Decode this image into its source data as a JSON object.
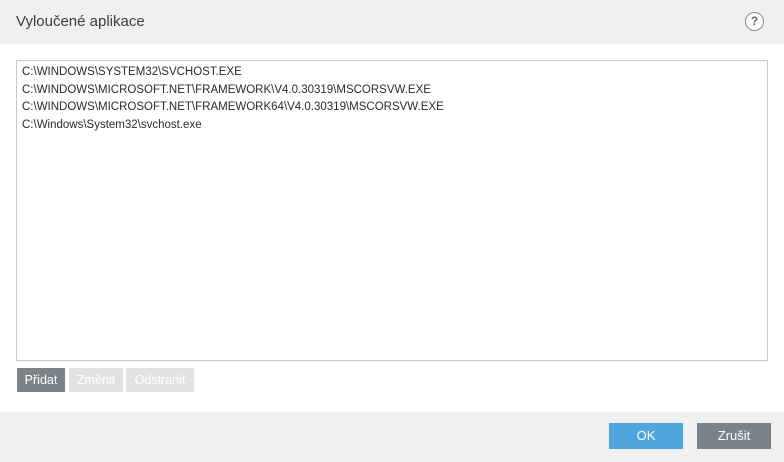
{
  "dialog": {
    "title": "Vyloučené aplikace",
    "help_icon": "question-mark-icon",
    "help_label": "?"
  },
  "list": {
    "items": [
      "C:\\WINDOWS\\SYSTEM32\\SVCHOST.EXE",
      "C:\\WINDOWS\\MICROSOFT.NET\\FRAMEWORK\\V4.0.30319\\MSCORSVW.EXE",
      "C:\\WINDOWS\\MICROSOFT.NET\\FRAMEWORK64\\V4.0.30319\\MSCORSVW.EXE",
      "C:\\Windows\\System32\\svchost.exe"
    ]
  },
  "actions": {
    "add_label": "Přidat",
    "edit_label": "Změnit",
    "remove_label": "Odstranit"
  },
  "footer": {
    "ok_label": "OK",
    "cancel_label": "Zrušit"
  },
  "colors": {
    "accent": "#4ea6dc",
    "button_gray": "#7b8388",
    "button_disabled": "#e2e2e2",
    "panel_bg": "#f0f0f0"
  }
}
